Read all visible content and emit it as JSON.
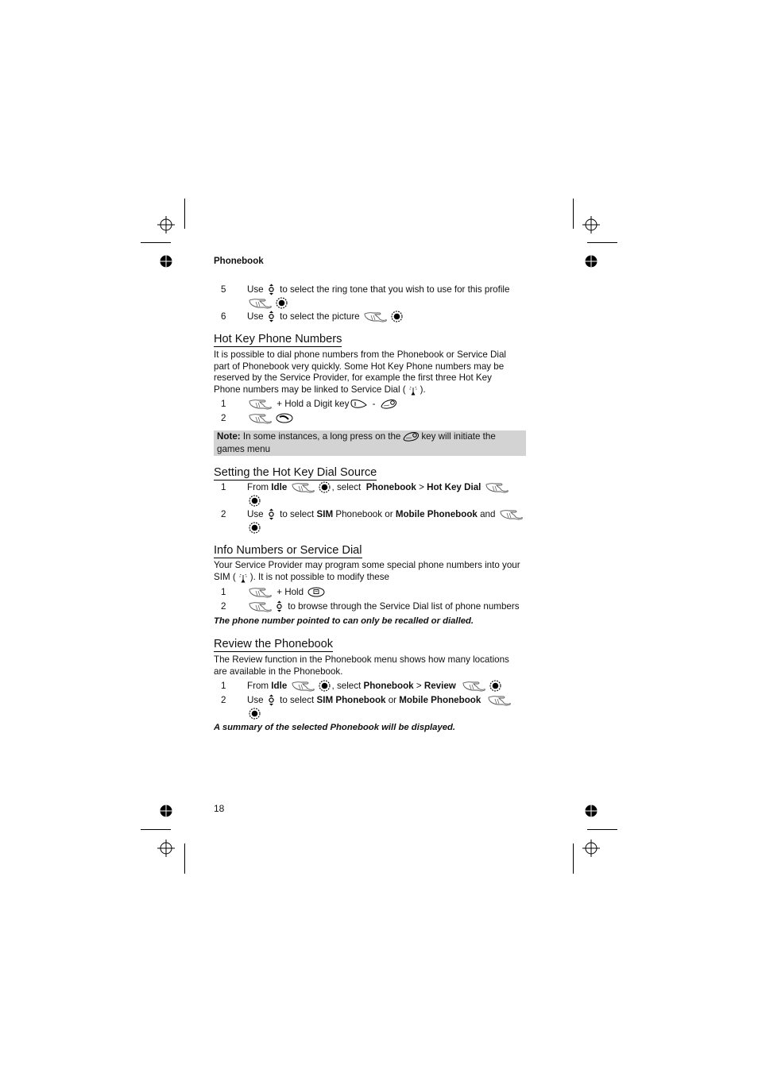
{
  "page": {
    "running_head": "Phonebook",
    "page_number": "18"
  },
  "intro_steps": [
    {
      "num": "5",
      "pre": "Use",
      "text": "to select the ring tone that you wish to use for this profile"
    },
    {
      "num": "6",
      "pre": "Use",
      "text": "to select the picture"
    }
  ],
  "hot_key": {
    "heading": "Hot Key Phone Numbers",
    "paragraph_lines": [
      "It is possible to dial phone numbers from the Phonebook or Service Dial",
      "part of Phonebook very quickly. Some Hot Key Phone numbers may be",
      "reserved by the Service Provider, for example the first three Hot Key",
      "Phone numbers may be linked to Service Dial ("
    ],
    "paragraph_end": ").",
    "steps": [
      {
        "num": "1",
        "text": "+ Hold a Digit key",
        "dash": "-"
      },
      {
        "num": "2"
      }
    ],
    "note": {
      "label": "Note:",
      "text_before": "In some instances, a long press on the",
      "text_after": "key will initiate the",
      "text_line2": "games menu"
    }
  },
  "dial_source": {
    "heading": "Setting the Hot Key Dial Source",
    "steps": [
      {
        "num": "1",
        "from": "From",
        "idle": "Idle",
        "select": ", select",
        "phonebook": "Phonebook",
        "gt": ">",
        "item": "Hot Key Dial"
      },
      {
        "num": "2",
        "pre": "Use",
        "text1": "to select",
        "sim": "SIM",
        "text2": "Phonebook or",
        "mobile": "Mobile Phonebook",
        "text3": "and"
      }
    ]
  },
  "info_numbers": {
    "heading": "Info Numbers or Service Dial",
    "paragraph_line1": "Your Service Provider may program some special phone numbers into your",
    "paragraph_line2_pre": "SIM (",
    "paragraph_line2_post": "). It is not possible to modify these",
    "steps": [
      {
        "num": "1",
        "text": "+ Hold"
      },
      {
        "num": "2",
        "text": "to browse through the Service Dial list of phone numbers"
      }
    ],
    "footnote": "The phone number pointed to can only be recalled or dialled."
  },
  "review": {
    "heading": "Review the Phonebook",
    "paragraph_lines": [
      "The Review function in the Phonebook menu shows how many locations",
      "are available in the Phonebook."
    ],
    "steps": [
      {
        "num": "1",
        "from": "From",
        "idle": "Idle",
        "select": ", select",
        "phonebook": "Phonebook",
        "gt": ">",
        "item": "Review"
      },
      {
        "num": "2",
        "pre": "Use",
        "text1": "to select",
        "sim": "SIM Phonebook",
        "or": "or",
        "mobile": "Mobile Phonebook"
      }
    ],
    "footnote": "A summary of the selected Phonebook will be displayed."
  },
  "icons": {
    "nav": "navigation-key-icon",
    "hand": "menu-press-hand-icon",
    "ok": "ok-select-key-icon",
    "digit1": "digit-1-key-icon",
    "digit9": "digit-9-key-icon",
    "call": "call-send-key-icon",
    "antenna": "service-dial-antenna-icon",
    "phonebook_key": "phonebook-key-icon"
  }
}
